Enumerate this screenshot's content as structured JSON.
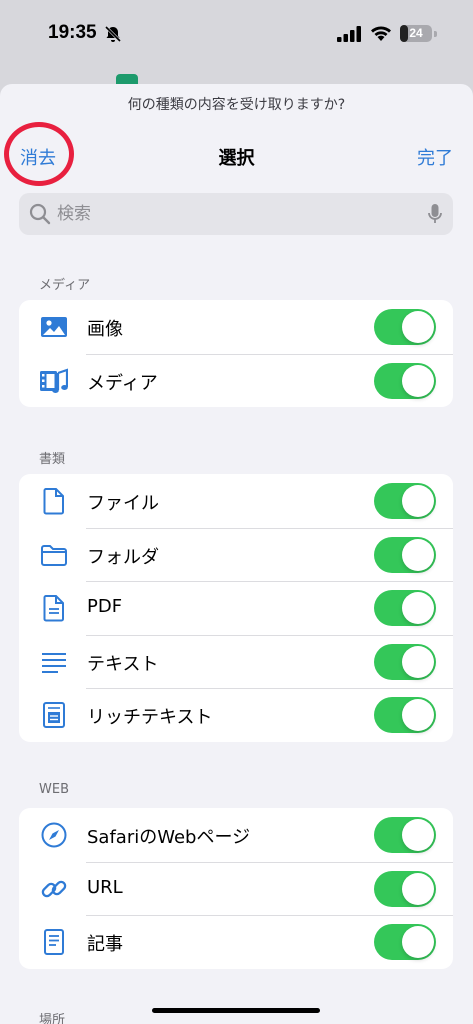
{
  "status_bar": {
    "time": "19:35",
    "battery": "24",
    "battery_level": 0.24
  },
  "sheet": {
    "prompt": "何の種類の内容を受け取りますか?",
    "clear_label": "消去",
    "title": "選択",
    "done_label": "完了"
  },
  "search": {
    "placeholder": "検索"
  },
  "sections": [
    {
      "header": "メディア",
      "items": [
        {
          "label": "画像",
          "icon": "photo-icon",
          "on": true
        },
        {
          "label": "メディア",
          "icon": "media-icon",
          "on": true
        }
      ]
    },
    {
      "header": "書類",
      "items": [
        {
          "label": "ファイル",
          "icon": "file-icon",
          "on": true
        },
        {
          "label": "フォルダ",
          "icon": "folder-icon",
          "on": true
        },
        {
          "label": "PDF",
          "icon": "pdf-icon",
          "on": true
        },
        {
          "label": "テキスト",
          "icon": "text-icon",
          "on": true
        },
        {
          "label": "リッチテキスト",
          "icon": "rich-text-icon",
          "on": true
        }
      ]
    },
    {
      "header": "WEB",
      "items": [
        {
          "label": "SafariのWebページ",
          "icon": "safari-icon",
          "on": true
        },
        {
          "label": "URL",
          "icon": "link-icon",
          "on": true
        },
        {
          "label": "記事",
          "icon": "article-icon",
          "on": true
        }
      ]
    },
    {
      "header": "場所",
      "items": []
    }
  ],
  "colors": {
    "accent": "#2f7bd6",
    "toggle_on": "#34c759",
    "annotation": "#e8203f"
  }
}
